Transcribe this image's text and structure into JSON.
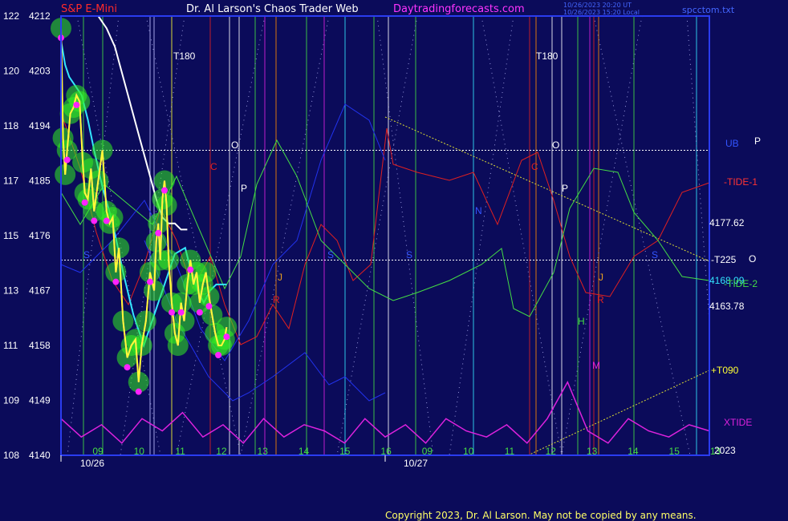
{
  "header": {
    "title_left": "S&P E-Mini",
    "title_center": "Dr. Al Larson's Chaos Trader Web",
    "title_right": "Daytradingforecasts.com",
    "stamp_line1": "10/26/2023 20:20 UT",
    "stamp_line2": "10/26/2023 15:20 Local",
    "filename": "spcctom.txt"
  },
  "colors": {
    "background": "#0b0b5a",
    "plot_border": "#2a3cf0",
    "title_left": "#ff2a2a",
    "title_center": "#ffffff",
    "title_right": "#ff33ff",
    "price": "#ffff33",
    "glow": "#33ee22",
    "dots": "#ff22ff",
    "white_ma": "#ffffff",
    "cyan_ma": "#33e6ff",
    "red_tide": "#e02020",
    "green_tide": "#44dd44",
    "blue_band": "#2233ee",
    "xtide": "#dd22dd",
    "yellow_trend": "#dddd33",
    "copyright": "#ffff66"
  },
  "chart_data": {
    "type": "line",
    "title": "S&P E-Mini",
    "y_left_labels": [
      {
        "scale": "122",
        "price": "4212"
      },
      {
        "scale": "120",
        "price": "4203"
      },
      {
        "scale": "118",
        "price": "4194"
      },
      {
        "scale": "117",
        "price": "4185"
      },
      {
        "scale": "115",
        "price": "4176"
      },
      {
        "scale": "113",
        "price": "4167"
      },
      {
        "scale": "111",
        "price": "4158"
      },
      {
        "scale": "109",
        "price": "4149"
      },
      {
        "scale": "108",
        "price": "4140"
      }
    ],
    "ylim": [
      4140,
      4212
    ],
    "x_hour_labels": [
      "09",
      "10",
      "11",
      "12",
      "13",
      "14",
      "15",
      "16",
      "09",
      "10",
      "11",
      "12",
      "13",
      "14",
      "15",
      "13"
    ],
    "x_date_labels": [
      "10/26",
      "10/27"
    ],
    "right_labels": [
      {
        "text": "UB",
        "color": "#3355ff"
      },
      {
        "text": "P",
        "color": "#ffffff"
      },
      {
        "text": "-TIDE-1",
        "color": "#ff3333"
      },
      {
        "text": "4177.62",
        "color": "#ffffff"
      },
      {
        "text": "-T225",
        "color": "#ffffff"
      },
      {
        "text": "O",
        "color": "#ffffff"
      },
      {
        "text": "4168.09",
        "color": "#33e6ff"
      },
      {
        "text": "-TIDE-2",
        "color": "#44dd44"
      },
      {
        "text": "4163.78",
        "color": "#ffffff"
      },
      {
        "text": "+T090",
        "color": "#ffff33"
      },
      {
        "text": "XTIDE",
        "color": "#dd22dd"
      },
      {
        "text": "2023",
        "color": "#ffffff"
      }
    ],
    "chart_annotations": [
      {
        "text": "T180",
        "color": "#ffffff"
      },
      {
        "text": "T180",
        "color": "#ffffff"
      },
      {
        "text": "O",
        "color": "#ffffff"
      },
      {
        "text": "O",
        "color": "#ffffff"
      },
      {
        "text": "P",
        "color": "#ffffff"
      },
      {
        "text": "P",
        "color": "#ffffff"
      },
      {
        "text": "C",
        "color": "#e02020"
      },
      {
        "text": "C",
        "color": "#e02020"
      },
      {
        "text": "N",
        "color": "#3355ff"
      },
      {
        "text": "S",
        "color": "#3355ff"
      },
      {
        "text": "S",
        "color": "#3355ff"
      },
      {
        "text": "S",
        "color": "#3355ff"
      },
      {
        "text": "S",
        "color": "#3355ff"
      },
      {
        "text": "J",
        "color": "#e8a020"
      },
      {
        "text": "J",
        "color": "#e8a020"
      },
      {
        "text": "R",
        "color": "#e02020"
      },
      {
        "text": "R",
        "color": "#e02020"
      },
      {
        "text": "H",
        "color": "#44dd44"
      },
      {
        "text": "M",
        "color": "#dd22dd"
      }
    ],
    "series": [
      {
        "name": "Price",
        "x": [
          0,
          0.1,
          0.2,
          0.3,
          0.45,
          0.6,
          0.75,
          0.9,
          1.05,
          1.15,
          1.3,
          1.45,
          1.6,
          1.8,
          2.0,
          2.2,
          2.35,
          2.5,
          2.65,
          2.8,
          3.0,
          3.2,
          3.4,
          3.6,
          3.75,
          3.9,
          4.1,
          4.3,
          4.5,
          4.6,
          4.7,
          4.8,
          4.9,
          5.0,
          5.1,
          5.2,
          5.35,
          5.5,
          5.65,
          5.8,
          5.95,
          6.1,
          6.25,
          6.4,
          6.55,
          6.7,
          6.85,
          7.0,
          7.15,
          7.3,
          7.45,
          7.6,
          7.75,
          7.9,
          8.0
        ],
        "y": [
          4210,
          4192,
          4186,
          4190,
          4196,
          4197,
          4199,
          4198,
          4188,
          4183,
          4182,
          4187,
          4180,
          4185,
          4190,
          4180,
          4178,
          4179,
          4170,
          4174,
          4162,
          4156,
          4158,
          4159,
          4152,
          4158,
          4162,
          4170,
          4167,
          4175,
          4178,
          4172,
          4182,
          4185,
          4181,
          4172,
          4165,
          4160,
          4158,
          4165,
          4162,
          4168,
          4172,
          4168,
          4170,
          4165,
          4168,
          4170,
          4166,
          4163,
          4160,
          4158,
          4158,
          4159,
          4161
        ]
      },
      {
        "name": "White MA",
        "x": [
          1.8,
          2.2,
          2.6,
          3.0,
          3.4,
          3.8,
          4.2,
          4.6,
          4.9,
          5.2,
          5.5,
          5.8,
          6.1
        ],
        "y": [
          4212,
          4210,
          4207,
          4202,
          4197,
          4192,
          4187,
          4182,
          4179,
          4178,
          4178,
          4177,
          4177
        ]
      },
      {
        "name": "Cyan MA",
        "x": [
          0,
          0.2,
          0.4,
          0.6,
          1.0,
          1.3,
          1.6,
          2.0,
          2.5,
          3.0,
          3.5,
          4.0,
          4.5,
          5.0,
          5.5,
          6.0,
          6.3,
          6.6,
          6.9,
          7.2,
          7.5,
          7.8,
          8.0
        ],
        "y": [
          4208,
          4204,
          4202,
          4201,
          4199,
          4195,
          4190,
          4184,
          4178,
          4170,
          4163,
          4158,
          4163,
          4168,
          4173,
          4174,
          4170,
          4167,
          4165,
          4167,
          4168,
          4168,
          4168
        ]
      },
      {
        "name": "XTIDE",
        "x": [
          0,
          0.5,
          1,
          1.5,
          2,
          2.5,
          3,
          3.5,
          4,
          4.5,
          5,
          5.5,
          6,
          6.5,
          7,
          7.5,
          8,
          8.5,
          9,
          9.5,
          10,
          10.5,
          11,
          11.5,
          12,
          12.5,
          13,
          13.5,
          14,
          14.5,
          15,
          15.5,
          16
        ],
        "y": [
          4146,
          4143,
          4145,
          4142,
          4146,
          4144,
          4147,
          4143,
          4145,
          4142,
          4146,
          4143,
          4145,
          4144,
          4142,
          4146,
          4143,
          4145,
          4142,
          4146,
          4144,
          4143,
          4145,
          4142,
          4146,
          4152,
          4144,
          4142,
          4146,
          4144,
          4143,
          4145,
          4144
        ]
      }
    ],
    "horizontal_lines": [
      4190,
      4172
    ],
    "grid": false,
    "legend": "none"
  },
  "footer": {
    "copyright": "Copyright 2023, Dr. Al Larson. May not be copied by any means."
  }
}
